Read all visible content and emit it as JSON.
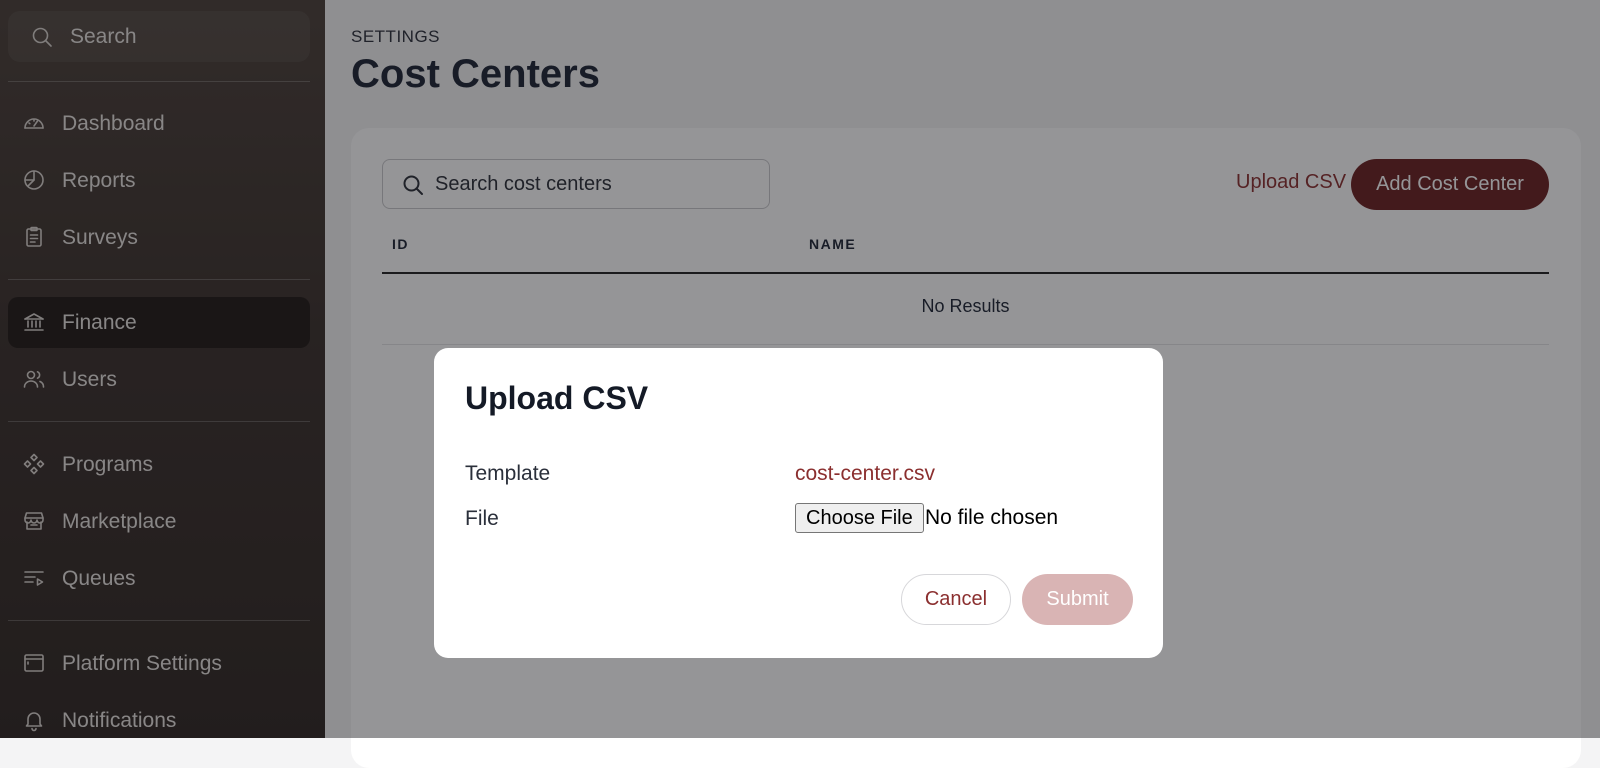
{
  "sidebar": {
    "search_label": "Search",
    "items": [
      {
        "label": "Dashboard",
        "icon": "gauge-icon"
      },
      {
        "label": "Reports",
        "icon": "pie-chart-icon"
      },
      {
        "label": "Surveys",
        "icon": "clipboard-icon"
      },
      {
        "label": "Finance",
        "icon": "bank-icon",
        "active": true
      },
      {
        "label": "Users",
        "icon": "users-icon"
      },
      {
        "label": "Programs",
        "icon": "diamond-grid-icon"
      },
      {
        "label": "Marketplace",
        "icon": "store-icon"
      },
      {
        "label": "Queues",
        "icon": "queue-list-icon"
      },
      {
        "label": "Platform Settings",
        "icon": "window-icon"
      },
      {
        "label": "Notifications",
        "icon": "bell-icon"
      }
    ]
  },
  "header": {
    "kicker": "SETTINGS",
    "title": "Cost Centers"
  },
  "toolbar": {
    "search_placeholder": "Search cost centers",
    "upload_label": "Upload CSV",
    "add_label": "Add Cost Center"
  },
  "table": {
    "columns": [
      "ID",
      "NAME"
    ],
    "empty_text": "No Results"
  },
  "modal": {
    "title": "Upload CSV",
    "template_label": "Template",
    "template_file": "cost-center.csv",
    "file_label": "File",
    "choose_file_label": "Choose File",
    "file_status": "No file chosen",
    "cancel_label": "Cancel",
    "submit_label": "Submit"
  },
  "colors": {
    "accent": "#6b1f1f",
    "link": "#8b2f2f",
    "submit_disabled": "#d9b4b4"
  }
}
